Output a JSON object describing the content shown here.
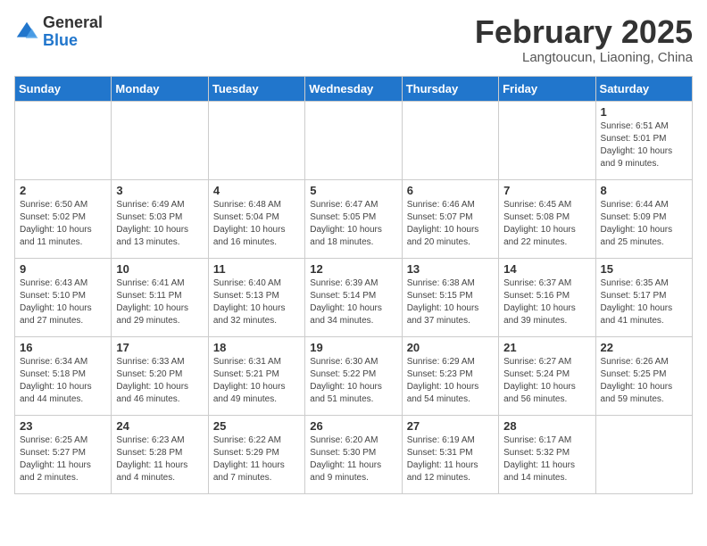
{
  "logo": {
    "general": "General",
    "blue": "Blue"
  },
  "title": "February 2025",
  "subtitle": "Langtoucun, Liaoning, China",
  "weekdays": [
    "Sunday",
    "Monday",
    "Tuesday",
    "Wednesday",
    "Thursday",
    "Friday",
    "Saturday"
  ],
  "weeks": [
    [
      {
        "day": "",
        "info": ""
      },
      {
        "day": "",
        "info": ""
      },
      {
        "day": "",
        "info": ""
      },
      {
        "day": "",
        "info": ""
      },
      {
        "day": "",
        "info": ""
      },
      {
        "day": "",
        "info": ""
      },
      {
        "day": "1",
        "info": "Sunrise: 6:51 AM\nSunset: 5:01 PM\nDaylight: 10 hours\nand 9 minutes."
      }
    ],
    [
      {
        "day": "2",
        "info": "Sunrise: 6:50 AM\nSunset: 5:02 PM\nDaylight: 10 hours\nand 11 minutes."
      },
      {
        "day": "3",
        "info": "Sunrise: 6:49 AM\nSunset: 5:03 PM\nDaylight: 10 hours\nand 13 minutes."
      },
      {
        "day": "4",
        "info": "Sunrise: 6:48 AM\nSunset: 5:04 PM\nDaylight: 10 hours\nand 16 minutes."
      },
      {
        "day": "5",
        "info": "Sunrise: 6:47 AM\nSunset: 5:05 PM\nDaylight: 10 hours\nand 18 minutes."
      },
      {
        "day": "6",
        "info": "Sunrise: 6:46 AM\nSunset: 5:07 PM\nDaylight: 10 hours\nand 20 minutes."
      },
      {
        "day": "7",
        "info": "Sunrise: 6:45 AM\nSunset: 5:08 PM\nDaylight: 10 hours\nand 22 minutes."
      },
      {
        "day": "8",
        "info": "Sunrise: 6:44 AM\nSunset: 5:09 PM\nDaylight: 10 hours\nand 25 minutes."
      }
    ],
    [
      {
        "day": "9",
        "info": "Sunrise: 6:43 AM\nSunset: 5:10 PM\nDaylight: 10 hours\nand 27 minutes."
      },
      {
        "day": "10",
        "info": "Sunrise: 6:41 AM\nSunset: 5:11 PM\nDaylight: 10 hours\nand 29 minutes."
      },
      {
        "day": "11",
        "info": "Sunrise: 6:40 AM\nSunset: 5:13 PM\nDaylight: 10 hours\nand 32 minutes."
      },
      {
        "day": "12",
        "info": "Sunrise: 6:39 AM\nSunset: 5:14 PM\nDaylight: 10 hours\nand 34 minutes."
      },
      {
        "day": "13",
        "info": "Sunrise: 6:38 AM\nSunset: 5:15 PM\nDaylight: 10 hours\nand 37 minutes."
      },
      {
        "day": "14",
        "info": "Sunrise: 6:37 AM\nSunset: 5:16 PM\nDaylight: 10 hours\nand 39 minutes."
      },
      {
        "day": "15",
        "info": "Sunrise: 6:35 AM\nSunset: 5:17 PM\nDaylight: 10 hours\nand 41 minutes."
      }
    ],
    [
      {
        "day": "16",
        "info": "Sunrise: 6:34 AM\nSunset: 5:18 PM\nDaylight: 10 hours\nand 44 minutes."
      },
      {
        "day": "17",
        "info": "Sunrise: 6:33 AM\nSunset: 5:20 PM\nDaylight: 10 hours\nand 46 minutes."
      },
      {
        "day": "18",
        "info": "Sunrise: 6:31 AM\nSunset: 5:21 PM\nDaylight: 10 hours\nand 49 minutes."
      },
      {
        "day": "19",
        "info": "Sunrise: 6:30 AM\nSunset: 5:22 PM\nDaylight: 10 hours\nand 51 minutes."
      },
      {
        "day": "20",
        "info": "Sunrise: 6:29 AM\nSunset: 5:23 PM\nDaylight: 10 hours\nand 54 minutes."
      },
      {
        "day": "21",
        "info": "Sunrise: 6:27 AM\nSunset: 5:24 PM\nDaylight: 10 hours\nand 56 minutes."
      },
      {
        "day": "22",
        "info": "Sunrise: 6:26 AM\nSunset: 5:25 PM\nDaylight: 10 hours\nand 59 minutes."
      }
    ],
    [
      {
        "day": "23",
        "info": "Sunrise: 6:25 AM\nSunset: 5:27 PM\nDaylight: 11 hours\nand 2 minutes."
      },
      {
        "day": "24",
        "info": "Sunrise: 6:23 AM\nSunset: 5:28 PM\nDaylight: 11 hours\nand 4 minutes."
      },
      {
        "day": "25",
        "info": "Sunrise: 6:22 AM\nSunset: 5:29 PM\nDaylight: 11 hours\nand 7 minutes."
      },
      {
        "day": "26",
        "info": "Sunrise: 6:20 AM\nSunset: 5:30 PM\nDaylight: 11 hours\nand 9 minutes."
      },
      {
        "day": "27",
        "info": "Sunrise: 6:19 AM\nSunset: 5:31 PM\nDaylight: 11 hours\nand 12 minutes."
      },
      {
        "day": "28",
        "info": "Sunrise: 6:17 AM\nSunset: 5:32 PM\nDaylight: 11 hours\nand 14 minutes."
      },
      {
        "day": "",
        "info": ""
      }
    ]
  ]
}
